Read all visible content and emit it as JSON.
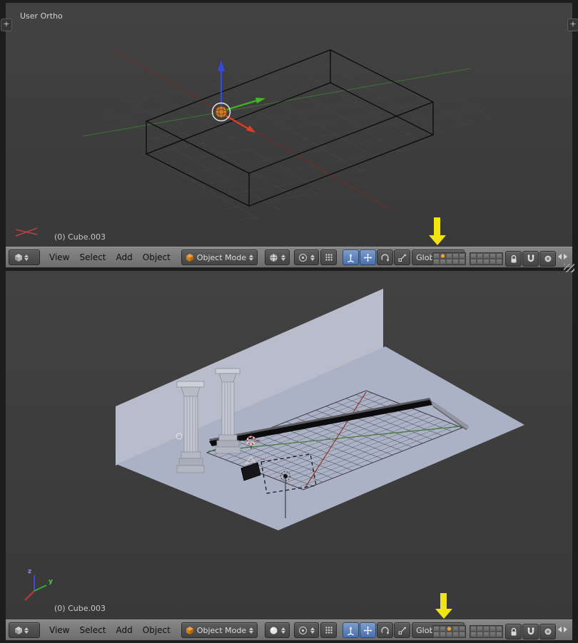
{
  "icons": {
    "plus": "+"
  },
  "viewport_top": {
    "view_label": "User Ortho",
    "object_info": "(0) Cube.003"
  },
  "viewport_bottom": {
    "object_info": "(0) Cube.003",
    "gizmo_axis_y": "y",
    "gizmo_axis_z": "z"
  },
  "header_top": {
    "menus": [
      "View",
      "Select",
      "Add",
      "Object"
    ],
    "mode_label": "Object Mode",
    "orientation_label": "Global",
    "active_layer": 1
  },
  "header_bottom": {
    "menus": [
      "View",
      "Select",
      "Add",
      "Object"
    ],
    "mode_label": "Object Mode",
    "orientation_label": "Global",
    "active_layer": 2
  },
  "colors": {
    "viewport_bg": "#3d3d3d",
    "wall": "#b9bdcb",
    "floor": "#acb2c6",
    "accent_pressed_blue": "#496fae",
    "active_layer_orange": "#f0a032",
    "annotation_arrow_yellow": "#f0e511",
    "axis_x_red": "#c23b33",
    "axis_y_green": "#2fae2f",
    "axis_z_blue": "#4347dd"
  }
}
